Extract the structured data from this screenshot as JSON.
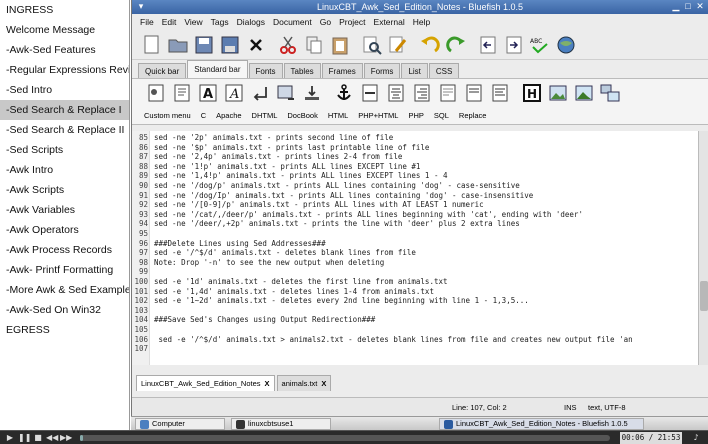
{
  "left_menu": [
    "INGRESS",
    "Welcome Message",
    "-Awk-Sed Features",
    "-Regular Expressions Revi",
    "-Sed Intro",
    "-Sed Search & Replace I",
    "-Sed Search & Replace II",
    "-Sed Scripts",
    "-Awk Intro",
    "-Awk Scripts",
    "-Awk Variables",
    "-Awk Operators",
    "-Awk Process Records",
    "-Awk- Printf Formatting",
    "-More Awk & Sed Examples",
    "-Awk-Sed On Win32",
    "EGRESS"
  ],
  "left_menu_selected": "-Sed Search & Replace I",
  "window": {
    "title": "LinuxCBT_Awk_Sed_Edition_Notes - Bluefish 1.0.5"
  },
  "menubar": [
    "File",
    "Edit",
    "View",
    "Tags",
    "Dialogs",
    "Document",
    "Go",
    "Project",
    "External",
    "Help"
  ],
  "tabs": [
    "Quick bar",
    "Standard bar",
    "Fonts",
    "Tables",
    "Frames",
    "Forms",
    "List",
    "CSS"
  ],
  "active_tab": "Standard bar",
  "toolbar3": [
    "Custom menu",
    "C",
    "Apache",
    "DHTML",
    "DocBook",
    "HTML",
    "PHP+HTML",
    "PHP",
    "SQL",
    "Replace"
  ],
  "lines": [
    {
      "n": "85",
      "t": "sed -ne '2p' animals.txt - prints second line of file"
    },
    {
      "n": "86",
      "t": "sed -ne '$p' animals.txt - prints last printable line of file"
    },
    {
      "n": "87",
      "t": "sed -ne '2,4p' animals.txt - prints lines 2-4 from file"
    },
    {
      "n": "88",
      "t": "sed -ne '1!p' animals.txt - prints ALL lines EXCEPT line #1"
    },
    {
      "n": "89",
      "t": "sed -ne '1,4!p' animals.txt - prints ALL lines EXCEPT lines 1 - 4"
    },
    {
      "n": "90",
      "t": "sed -ne '/dog/p' animals.txt - prints ALL lines containing 'dog' - case-sensitive"
    },
    {
      "n": "91",
      "t": "sed -ne '/dog/Ip' animals.txt - prints ALL lines containing 'dog' - case-insensitive"
    },
    {
      "n": "92",
      "t": "sed -ne '/[0-9]/p' animals.txt - prints ALL lines with AT LEAST 1 numeric"
    },
    {
      "n": "93",
      "t": "sed -ne '/cat/,/deer/p' animals.txt - prints ALL lines beginning with 'cat', ending with 'deer'"
    },
    {
      "n": "94",
      "t": "sed -ne '/deer/,+2p' animals.txt - prints the line with 'deer' plus 2 extra lines"
    },
    {
      "n": "95",
      "t": ""
    },
    {
      "n": "96",
      "t": "###Delete Lines using Sed Addresses###"
    },
    {
      "n": "97",
      "t": "sed -e '/^$/d' animals.txt - deletes blank lines from file"
    },
    {
      "n": "98",
      "t": "Note: Drop '-n' to see the new output when deleting"
    },
    {
      "n": "99",
      "t": ""
    },
    {
      "n": "100",
      "t": "sed -e '1d' animals.txt - deletes the first line from animals.txt"
    },
    {
      "n": "101",
      "t": "sed -e '1,4d' animals.txt - deletes lines 1-4 from animals.txt"
    },
    {
      "n": "102",
      "t": "sed -e '1~2d' animals.txt - deletes every 2nd line beginning with line 1 - 1,3,5..."
    },
    {
      "n": "103",
      "t": ""
    },
    {
      "n": "104",
      "t": "###Save Sed's Changes using Output Redirection###"
    },
    {
      "n": "105",
      "t": ""
    },
    {
      "n": "106",
      "t": " sed -e '/^$/d' animals.txt > animals2.txt - deletes blank lines from file and creates new output file 'an"
    },
    {
      "n": "107",
      "t": ""
    }
  ],
  "doc_tabs": [
    {
      "label": "LinuxCBT_Awk_Sed_Edition_Notes",
      "close": "X"
    },
    {
      "label": "animals.txt",
      "close": "X"
    }
  ],
  "status": {
    "position": "Line: 107, Col: 2",
    "mode": "INS",
    "encoding": "text, UTF-8"
  },
  "taskbar": [
    "Computer",
    "linuxcbtsuse1",
    "LinuxCBT_Awk_Sed_Edition_Notes - Bluefish 1.0.5"
  ],
  "player": {
    "time": "00:06 / 21:53",
    "progress": 0.005
  }
}
